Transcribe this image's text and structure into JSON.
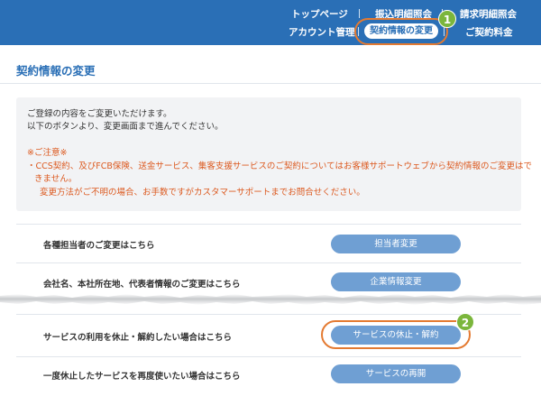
{
  "header": {
    "top_links": [
      "トップページ",
      "振込明細照会",
      "請求明細照会"
    ],
    "bottom_links": {
      "account": "アカウント管理",
      "contract_change": "契約情報の変更",
      "contract_fee": "ご契約料金"
    },
    "callout_1": "1"
  },
  "page": {
    "title": "契約情報の変更"
  },
  "notice": {
    "line1": "ご登録の内容をご変更いただけます。",
    "line2": "以下のボタンより、変更画面まで進んでください。",
    "caution_title": "※ご注意※",
    "caution_line1": "・CCS契約、及びFCB保険、送金サービス、集客支援サービスのご契約についてはお客様サポートウェブから契約情報のご変更はで",
    "caution_line2": "きません。",
    "caution_line3": "変更方法がご不明の場合、お手数ですがカスタマーサポートまでお問合せください。"
  },
  "rows": [
    {
      "label": "各種担当者のご変更はこちら",
      "button": "担当者変更"
    },
    {
      "label": "会社名、本社所在地、代表者情報のご変更はこちら",
      "button": "企業情報変更"
    },
    {
      "label": "サービスの利用を休止・解約したい場合はこちら",
      "button": "サービスの休止・解約"
    },
    {
      "label": "一度休止したサービスを再度使いたい場合はこちら",
      "button": "サービスの再開"
    }
  ],
  "callout_2": "2",
  "colors": {
    "header": "#2a6fb6",
    "button": "#6f9fd3",
    "highlight": "#e47a31",
    "badge": "#7bb63c",
    "warning_text": "#dc5a20"
  }
}
